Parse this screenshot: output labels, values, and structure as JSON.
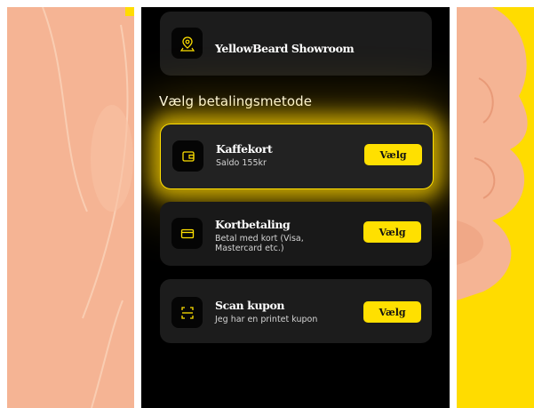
{
  "showroom": {
    "title": "YellowBeard Showroom",
    "icon": "location-pin-icon"
  },
  "section_title": "Vælg betalingsmetode",
  "methods": [
    {
      "title": "Kaffekort",
      "subtitle": "Saldo 155kr",
      "button": "Vælg",
      "icon": "wallet-icon",
      "selected": true
    },
    {
      "title": "Kortbetaling",
      "subtitle": "Betal med kort (Visa, Mastercard etc.)",
      "button": "Vælg",
      "icon": "credit-card-icon",
      "selected": false
    },
    {
      "title": "Scan kupon",
      "subtitle": "Jeg har en printet kupon",
      "button": "Vælg",
      "icon": "scan-icon",
      "selected": false
    }
  ],
  "colors": {
    "accent": "#ffe000",
    "background": "#000000",
    "card": "#1c1c1c",
    "skin": "#f5b494"
  }
}
